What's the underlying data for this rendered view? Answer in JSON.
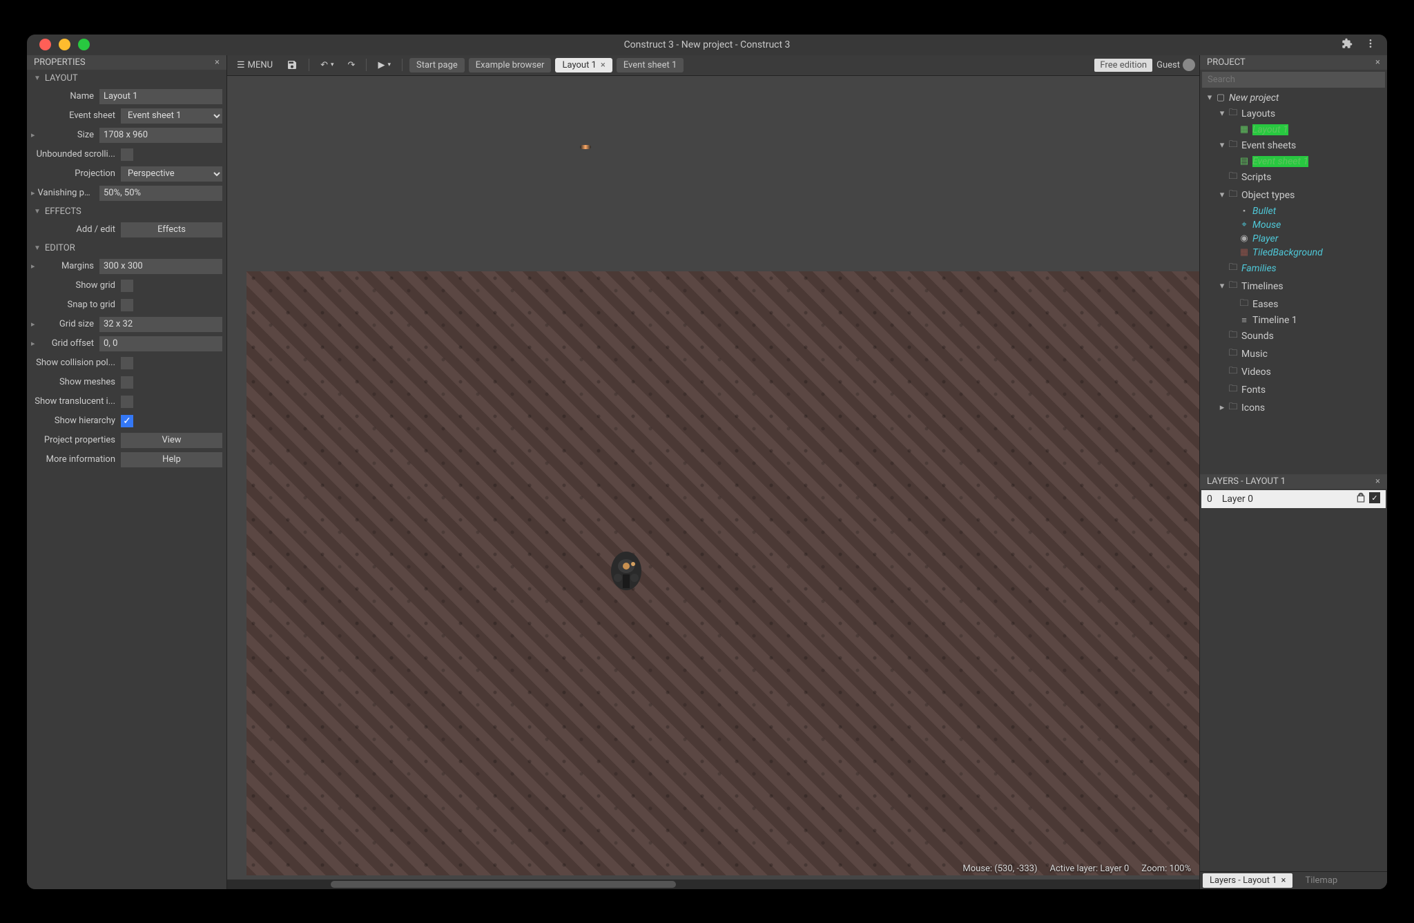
{
  "titlebar": {
    "title": "Construct 3 - New project - Construct 3"
  },
  "menu": {
    "label": "MENU"
  },
  "tabs": {
    "start": "Start page",
    "examples": "Example browser",
    "layout": "Layout 1",
    "events": "Event sheet 1"
  },
  "toolbar_right": {
    "free": "Free edition",
    "guest": "Guest"
  },
  "panels": {
    "properties": "PROPERTIES",
    "project": "PROJECT",
    "layers": "LAYERS - LAYOUT 1"
  },
  "sections": {
    "layout": "LAYOUT",
    "effects": "EFFECTS",
    "editor": "EDITOR"
  },
  "props": {
    "name_lbl": "Name",
    "name_val": "Layout 1",
    "eventsheet_lbl": "Event sheet",
    "eventsheet_val": "Event sheet 1",
    "size_lbl": "Size",
    "size_val": "1708 x 960",
    "unbounded_lbl": "Unbounded scrolli...",
    "projection_lbl": "Projection",
    "projection_val": "Perspective",
    "vanishing_lbl": "Vanishing point",
    "vanishing_val": "50%, 50%",
    "addedit_lbl": "Add / edit",
    "effects_btn": "Effects",
    "margins_lbl": "Margins",
    "margins_val": "300 x 300",
    "showgrid_lbl": "Show grid",
    "snapgrid_lbl": "Snap to grid",
    "gridsize_lbl": "Grid size",
    "gridsize_val": "32 x 32",
    "gridoffset_lbl": "Grid offset",
    "gridoffset_val": "0, 0",
    "collision_lbl": "Show collision pol...",
    "meshes_lbl": "Show meshes",
    "translucent_lbl": "Show translucent i...",
    "hierarchy_lbl": "Show hierarchy",
    "projprops_lbl": "Project properties",
    "view_btn": "View",
    "moreinfo_lbl": "More information",
    "help_btn": "Help"
  },
  "search_ph": "Search",
  "tree": {
    "project": "New project",
    "layouts": "Layouts",
    "layout1": "Layout 1",
    "eventsheets": "Event sheets",
    "es1": "Event sheet 1",
    "scripts": "Scripts",
    "objtypes": "Object types",
    "bullet": "Bullet",
    "mouse": "Mouse",
    "player": "Player",
    "tiledbg": "TiledBackground",
    "families": "Families",
    "timelines": "Timelines",
    "eases": "Eases",
    "timeline1": "Timeline 1",
    "sounds": "Sounds",
    "music": "Music",
    "videos": "Videos",
    "fonts": "Fonts",
    "icons": "Icons"
  },
  "layers": {
    "num": "0",
    "name": "Layer 0"
  },
  "status": {
    "mouse": "Mouse: (530, -333)",
    "active": "Active layer: Layer 0",
    "zoom": "Zoom: 100%"
  },
  "bottom_tabs": {
    "layers": "Layers - Layout 1",
    "tilemap": "Tilemap"
  }
}
